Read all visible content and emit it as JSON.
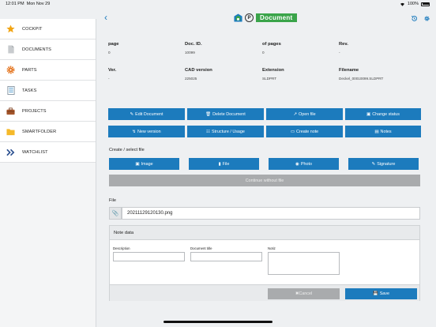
{
  "status": {
    "time": "12:01 PM",
    "date": "Mon Nov 29",
    "battery": "100%"
  },
  "header": {
    "title": "Document",
    "p_badge": "P"
  },
  "sidebar": {
    "items": [
      {
        "label": "COCKPIT",
        "icon": "star-icon"
      },
      {
        "label": "DOCUMENTS",
        "icon": "document-icon"
      },
      {
        "label": "PARTS",
        "icon": "gear-icon"
      },
      {
        "label": "TASKS",
        "icon": "task-list-icon"
      },
      {
        "label": "PROJECTS",
        "icon": "briefcase-icon"
      },
      {
        "label": "SMARTFOLDER",
        "icon": "folder-icon"
      },
      {
        "label": "WATCHLIST",
        "icon": "chevrons-icon"
      }
    ]
  },
  "meta": {
    "row1": [
      {
        "label": "page",
        "value": "0"
      },
      {
        "label": "Doc. ID.",
        "value": "10099"
      },
      {
        "label": "of pages",
        "value": "0"
      },
      {
        "label": "Rev.",
        "value": "-"
      }
    ],
    "row2": [
      {
        "label": "Ver.",
        "value": "-"
      },
      {
        "label": "CAD version",
        "value": "225025"
      },
      {
        "label": "Extension",
        "value": "SLDPRT"
      },
      {
        "label": "Filename",
        "value": "Deckel_00010099.SLDPRT"
      }
    ]
  },
  "actions": {
    "edit": "Edit Document",
    "delete": "Delete Document",
    "open": "Open file",
    "change_status": "Change status",
    "new_version": "New version",
    "structure": "Structure / Usage",
    "create_note": "Create note",
    "notes": "Notes"
  },
  "create": {
    "label": "Create / select file",
    "image": "Image",
    "file": "File",
    "photo": "Photo",
    "signature": "Signature",
    "continue": "Continue without file"
  },
  "file": {
    "label": "File",
    "value": "20211129120130.png"
  },
  "note": {
    "title": "Note data",
    "description_label": "Description",
    "doc_title_label": "Document title",
    "notiz_label": "Notiz",
    "cancel": "Cancel",
    "save": "Save"
  },
  "colors": {
    "accent": "#1c7bbd",
    "badge": "#3aa44a",
    "disabled": "#a9abad"
  }
}
